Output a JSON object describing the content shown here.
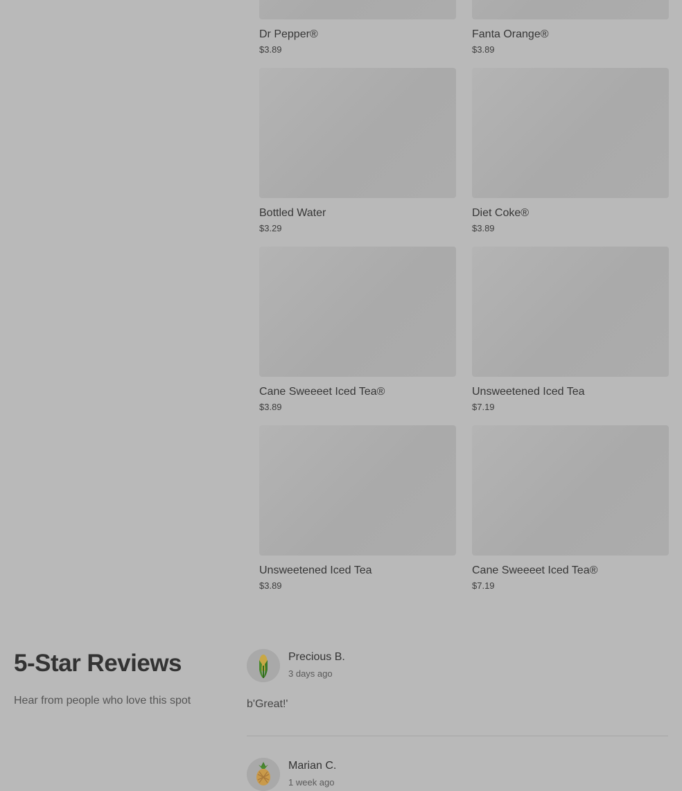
{
  "menu": {
    "items": [
      {
        "name": "Dr Pepper®",
        "price": "$3.89"
      },
      {
        "name": "Fanta Orange®",
        "price": "$3.89"
      },
      {
        "name": "Bottled Water",
        "price": "$3.29"
      },
      {
        "name": "Diet Coke®",
        "price": "$3.89"
      },
      {
        "name": "Cane Sweeeet Iced Tea®",
        "price": "$3.89"
      },
      {
        "name": "Unsweetened Iced Tea",
        "price": "$7.19"
      },
      {
        "name": "Unsweetened Iced Tea",
        "price": "$3.89"
      },
      {
        "name": "Cane Sweeeet Iced Tea®",
        "price": "$7.19"
      }
    ]
  },
  "reviews": {
    "title": "5-Star Reviews",
    "subtitle": "Hear from people who love this spot",
    "items": [
      {
        "author": "Precious B.",
        "time": "3 days ago",
        "text": "b'Great!'",
        "avatar_icon": "corn-icon"
      },
      {
        "author": "Marian C.",
        "time": "1 week ago",
        "text": "",
        "avatar_icon": "pineapple-icon"
      }
    ]
  }
}
